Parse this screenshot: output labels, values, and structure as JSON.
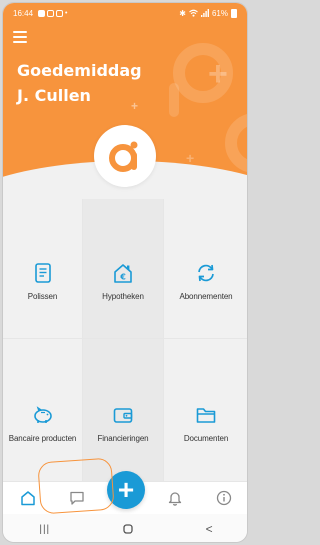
{
  "status_bar": {
    "time": "16:44",
    "battery": "61%",
    "icons": [
      "notification-icon",
      "bluetooth-icon",
      "wifi-icon",
      "signal-icon",
      "battery-icon"
    ]
  },
  "header": {
    "greeting_line1": "Goedemiddag",
    "greeting_line2": "J. Cullen",
    "menu_icon": "hamburger-menu-icon",
    "logo": "brand-logo"
  },
  "tiles": [
    {
      "label": "Polissen",
      "icon": "document-icon"
    },
    {
      "label": "Hypotheken",
      "icon": "house-euro-icon"
    },
    {
      "label": "Abonnementen",
      "icon": "refresh-icon"
    },
    {
      "label": "Bancaire producten",
      "icon": "piggy-bank-icon"
    },
    {
      "label": "Financieringen",
      "icon": "wallet-icon"
    },
    {
      "label": "Documenten",
      "icon": "folder-icon"
    }
  ],
  "bottom_nav": {
    "items": [
      "home-icon",
      "chat-icon",
      "add-icon",
      "bell-icon",
      "info-icon"
    ],
    "fab_symbol": "+"
  },
  "system_nav": {
    "recents": "|||",
    "back": "<"
  },
  "colors": {
    "brand_orange": "#f7943d",
    "accent_blue": "#1a9ad6",
    "background": "#f1f1f1"
  }
}
